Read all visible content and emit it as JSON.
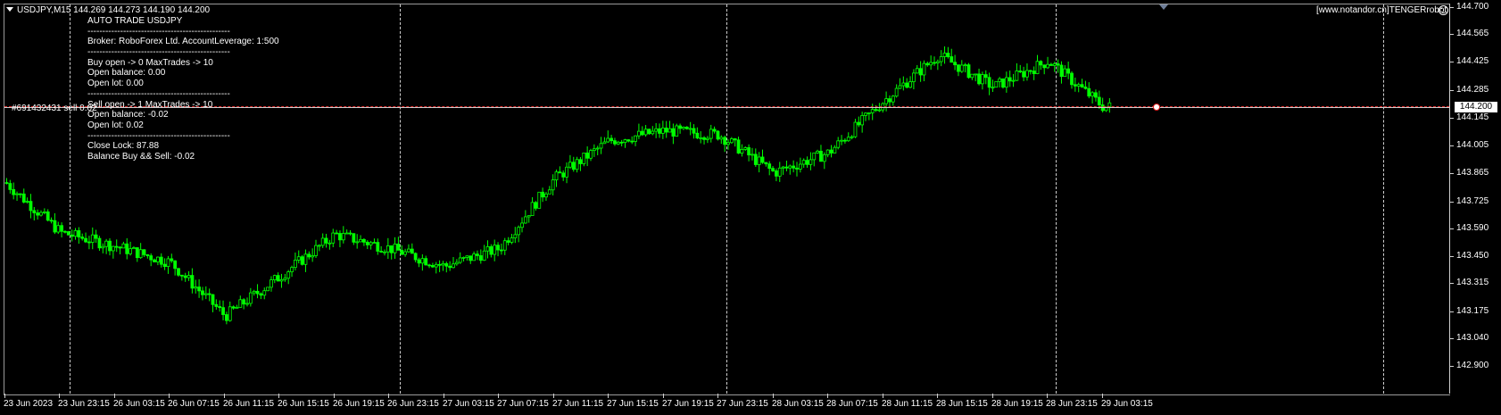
{
  "chart": {
    "symbol_title": "USDJPY,M15  144.269 144.273 144.190 144.200",
    "watermark": "[www.notandor.cn]TENGERrobot",
    "current_price": "144.200",
    "order_label": "#691432431 sell 0.02",
    "colors": {
      "background": "#000000",
      "bull_candle": "#00ff00",
      "bear_candle": "#00ff00",
      "grid": "#cfcfcf",
      "trade_line": "#e03030"
    },
    "icons": {
      "title_menu": "triangle-down-icon",
      "smile": "smiley-face-icon",
      "shift": "chart-shift-marker-icon"
    }
  },
  "ea_panel": {
    "lines": [
      "AUTO TRADE USDJPY",
      "------------------------------------------------",
      "Broker: RoboForex Ltd.  AccountLeverage: 1:500",
      "------------------------------------------------",
      "Buy open ->  0  MaxTrades ->  10",
      "Open balance: 0.00",
      "Open lot: 0.00",
      "------------------------------------------------",
      "Sell open ->  1  MaxTrades ->  10",
      "Open balance: -0.02",
      "Open lot: 0.02",
      "------------------------------------------------",
      "Close Lock:  87.88",
      "Balance Buy && Sell: -0.02"
    ]
  },
  "price_axis": [
    "144.700",
    "144.565",
    "144.425",
    "144.285",
    "144.145",
    "144.005",
    "143.865",
    "143.725",
    "143.590",
    "143.450",
    "143.315",
    "143.175",
    "143.040",
    "142.900"
  ],
  "time_axis": [
    "23 Jun 2023",
    "23 Jun 23:15",
    "26 Jun 03:15",
    "26 Jun 07:15",
    "26 Jun 11:15",
    "26 Jun 15:15",
    "26 Jun 19:15",
    "26 Jun 23:15",
    "27 Jun 03:15",
    "27 Jun 07:15",
    "27 Jun 11:15",
    "27 Jun 15:15",
    "27 Jun 19:15",
    "27 Jun 23:15",
    "28 Jun 03:15",
    "28 Jun 07:15",
    "28 Jun 11:15",
    "28 Jun 15:15",
    "28 Jun 19:15",
    "28 Jun 23:15",
    "29 Jun 03:15"
  ],
  "chart_data": {
    "type": "candlestick",
    "title": "USDJPY,M15",
    "ylim": [
      142.9,
      144.7
    ],
    "current_price": 144.2,
    "series": [
      {
        "name": "USDJPY close (approx.)",
        "x": [
          "23 Jun 2023",
          "23 Jun 23:15",
          "26 Jun 03:15",
          "26 Jun 07:15",
          "26 Jun 11:15",
          "26 Jun 15:15",
          "26 Jun 19:15",
          "26 Jun 23:15",
          "27 Jun 03:15",
          "27 Jun 07:15",
          "27 Jun 11:15",
          "27 Jun 15:15",
          "27 Jun 19:15",
          "27 Jun 23:15",
          "28 Jun 03:15",
          "28 Jun 07:15",
          "28 Jun 11:15",
          "28 Jun 15:15",
          "28 Jun 19:15",
          "28 Jun 23:15",
          "29 Jun 03:15"
        ],
        "values": [
          143.82,
          143.57,
          143.5,
          143.42,
          143.15,
          143.35,
          143.56,
          143.49,
          143.4,
          143.49,
          143.84,
          144.03,
          144.08,
          144.06,
          143.87,
          143.97,
          144.23,
          144.46,
          144.3,
          144.43,
          144.2
        ]
      }
    ]
  }
}
